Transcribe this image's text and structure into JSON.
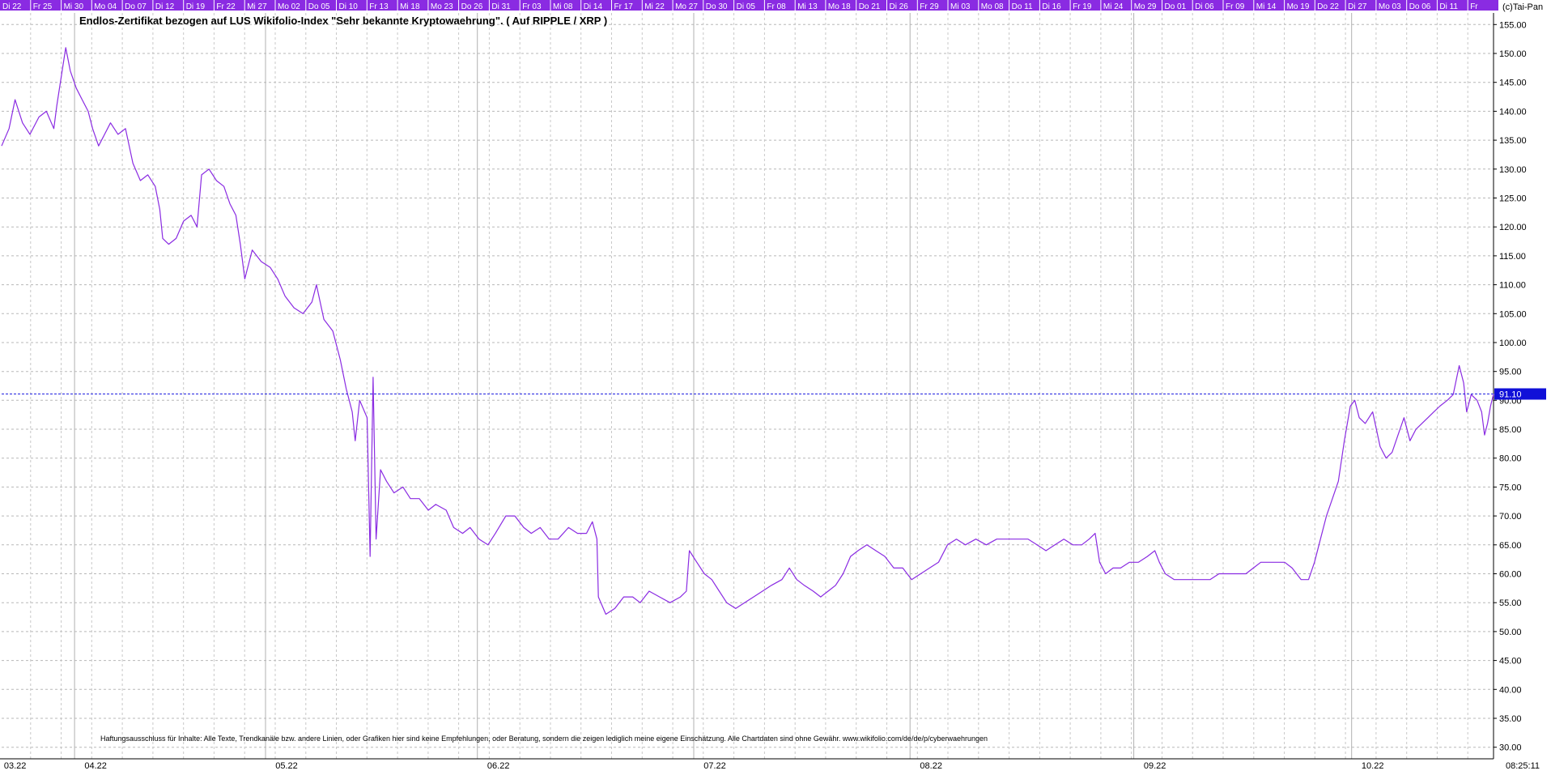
{
  "chart_data": {
    "type": "line",
    "title": "Endlos-Zertifikat bezogen auf LUS Wikifolio-Index \"Sehr bekannte Kryptowaehrung\". ( Auf RIPPLE / XRP )",
    "copyright": "(c)Tai-Pan",
    "disclaimer": "Haftungsausschluss für Inhalte: Alle Texte, Trendkanäle bzw. andere Linien, oder Grafiken hier sind keine Empfehlungen, oder Beratung, sondern die zeigen lediglich meine eigene Einschätzung. Alle Chartdaten sind ohne Gewähr.  www.wikifolio.com/de/de/p/cyberwaehrungen",
    "time_label": "08:25:11",
    "last_value_label": "91.10",
    "last_value": 91.1,
    "ylim": [
      28,
      157
    ],
    "y_ticks": [
      "30.00",
      "35.00",
      "40.00",
      "45.00",
      "50.00",
      "55.00",
      "60.00",
      "65.00",
      "70.00",
      "75.00",
      "80.00",
      "85.00",
      "90.00",
      "95.00",
      "100.00",
      "105.00",
      "110.00",
      "115.00",
      "120.00",
      "125.00",
      "130.00",
      "135.00",
      "140.00",
      "145.00",
      "150.00",
      "155.00"
    ],
    "x_range": [
      0,
      100
    ],
    "top_date_labels": [
      "Di 22",
      "Fr 25",
      "Mi 30",
      "Mo 04",
      "Do 07",
      "Di 12",
      "Di 19",
      "Fr 22",
      "Mi 27",
      "Mo 02",
      "Do 05",
      "Di 10",
      "Fr 13",
      "Mi 18",
      "Mo 23",
      "Do 26",
      "Di 31",
      "Fr 03",
      "Mi 08",
      "Di 14",
      "Fr 17",
      "Mi 22",
      "Mo 27",
      "Do 30",
      "Di 05",
      "Fr 08",
      "Mi 13",
      "Mo 18",
      "Do 21",
      "Di 26",
      "Fr 29",
      "Mi 03",
      "Mo 08",
      "Do 11",
      "Di 16",
      "Fr 19",
      "Mi 24",
      "Mo 29",
      "Do 01",
      "Di 06",
      "Fr 09",
      "Mi 14",
      "Mo 19",
      "Do 22",
      "Di 27",
      "Mo 03",
      "Do 06",
      "Di 11",
      "Fr"
    ],
    "bottom_month_labels": [
      "03.22",
      "04.22",
      "05.22",
      "06.22",
      "07.22",
      "08.22",
      "09.22",
      "10.22"
    ],
    "bottom_month_positions": [
      0.9,
      6.3,
      19.1,
      33.3,
      47.8,
      62.3,
      77.3,
      91.9
    ],
    "colors": {
      "line": "#8a2be2",
      "top_bar": "#8a2be2",
      "top_bar_text": "#ffffff",
      "grid": "#b8b8b8",
      "last_value_line": "#2020e0",
      "last_value_box": "#1010d8"
    },
    "series": [
      {
        "points": [
          [
            0.0,
            134
          ],
          [
            0.5,
            137
          ],
          [
            0.9,
            142
          ],
          [
            1.4,
            138
          ],
          [
            1.9,
            136
          ],
          [
            2.5,
            139
          ],
          [
            3.0,
            140
          ],
          [
            3.5,
            137
          ],
          [
            3.7,
            141
          ],
          [
            4.0,
            146
          ],
          [
            4.3,
            151
          ],
          [
            4.6,
            147
          ],
          [
            5.0,
            144
          ],
          [
            5.4,
            142
          ],
          [
            5.8,
            140
          ],
          [
            6.1,
            137
          ],
          [
            6.5,
            134
          ],
          [
            6.9,
            136
          ],
          [
            7.3,
            138
          ],
          [
            7.8,
            136
          ],
          [
            8.3,
            137
          ],
          [
            8.8,
            131
          ],
          [
            9.3,
            128
          ],
          [
            9.8,
            129
          ],
          [
            10.3,
            127
          ],
          [
            10.6,
            123
          ],
          [
            10.8,
            118
          ],
          [
            11.2,
            117
          ],
          [
            11.7,
            118
          ],
          [
            12.2,
            121
          ],
          [
            12.7,
            122
          ],
          [
            13.1,
            120
          ],
          [
            13.4,
            129
          ],
          [
            13.9,
            130
          ],
          [
            14.4,
            128
          ],
          [
            14.9,
            127
          ],
          [
            15.3,
            124
          ],
          [
            15.7,
            122
          ],
          [
            16.0,
            117
          ],
          [
            16.3,
            111
          ],
          [
            16.6,
            114
          ],
          [
            16.8,
            116
          ],
          [
            17.4,
            114
          ],
          [
            18.0,
            113
          ],
          [
            18.5,
            111
          ],
          [
            19.0,
            108
          ],
          [
            19.6,
            106
          ],
          [
            20.2,
            105
          ],
          [
            20.8,
            107
          ],
          [
            21.1,
            110
          ],
          [
            21.6,
            104
          ],
          [
            22.2,
            102
          ],
          [
            22.7,
            97
          ],
          [
            23.1,
            92
          ],
          [
            23.5,
            88
          ],
          [
            23.7,
            83
          ],
          [
            24.0,
            90
          ],
          [
            24.5,
            87
          ],
          [
            24.7,
            63
          ],
          [
            24.9,
            94
          ],
          [
            25.1,
            66
          ],
          [
            25.4,
            78
          ],
          [
            25.8,
            76
          ],
          [
            26.3,
            74
          ],
          [
            26.9,
            75
          ],
          [
            27.4,
            73
          ],
          [
            28.0,
            73
          ],
          [
            28.6,
            71
          ],
          [
            29.1,
            72
          ],
          [
            29.8,
            71
          ],
          [
            30.3,
            68
          ],
          [
            30.9,
            67
          ],
          [
            31.4,
            68
          ],
          [
            32.0,
            66
          ],
          [
            32.6,
            65
          ],
          [
            33.1,
            67
          ],
          [
            33.8,
            70
          ],
          [
            34.4,
            70
          ],
          [
            35.0,
            68
          ],
          [
            35.5,
            67
          ],
          [
            36.1,
            68
          ],
          [
            36.7,
            66
          ],
          [
            37.3,
            66
          ],
          [
            38.0,
            68
          ],
          [
            38.6,
            67
          ],
          [
            39.2,
            67
          ],
          [
            39.6,
            69
          ],
          [
            39.9,
            66
          ],
          [
            40.0,
            56
          ],
          [
            40.5,
            53
          ],
          [
            41.1,
            54
          ],
          [
            41.7,
            56
          ],
          [
            42.3,
            56
          ],
          [
            42.8,
            55
          ],
          [
            43.4,
            57
          ],
          [
            44.1,
            56
          ],
          [
            44.8,
            55
          ],
          [
            45.5,
            56
          ],
          [
            45.9,
            57
          ],
          [
            46.1,
            64
          ],
          [
            46.6,
            62
          ],
          [
            47.1,
            60
          ],
          [
            47.6,
            59
          ],
          [
            48.1,
            57
          ],
          [
            48.6,
            55
          ],
          [
            49.2,
            54
          ],
          [
            49.8,
            55
          ],
          [
            50.4,
            56
          ],
          [
            51.0,
            57
          ],
          [
            51.6,
            58
          ],
          [
            52.3,
            59
          ],
          [
            52.8,
            61
          ],
          [
            53.3,
            59
          ],
          [
            53.8,
            58
          ],
          [
            54.4,
            57
          ],
          [
            54.9,
            56
          ],
          [
            55.4,
            57
          ],
          [
            55.9,
            58
          ],
          [
            56.4,
            60
          ],
          [
            56.9,
            63
          ],
          [
            57.4,
            64
          ],
          [
            58.0,
            65
          ],
          [
            58.6,
            64
          ],
          [
            59.2,
            63
          ],
          [
            59.8,
            61
          ],
          [
            60.4,
            61
          ],
          [
            61.0,
            59
          ],
          [
            61.6,
            60
          ],
          [
            62.2,
            61
          ],
          [
            62.8,
            62
          ],
          [
            63.4,
            65
          ],
          [
            64.0,
            66
          ],
          [
            64.6,
            65
          ],
          [
            65.3,
            66
          ],
          [
            66.0,
            65
          ],
          [
            66.7,
            66
          ],
          [
            67.4,
            66
          ],
          [
            68.1,
            66
          ],
          [
            68.8,
            66
          ],
          [
            69.4,
            65
          ],
          [
            70.0,
            64
          ],
          [
            70.6,
            65
          ],
          [
            71.2,
            66
          ],
          [
            71.8,
            65
          ],
          [
            72.4,
            65
          ],
          [
            72.9,
            66
          ],
          [
            73.3,
            67
          ],
          [
            73.6,
            62
          ],
          [
            74.0,
            60
          ],
          [
            74.5,
            61
          ],
          [
            75.0,
            61
          ],
          [
            75.6,
            62
          ],
          [
            76.2,
            62
          ],
          [
            76.8,
            63
          ],
          [
            77.3,
            64
          ],
          [
            77.6,
            62
          ],
          [
            78.0,
            60
          ],
          [
            78.6,
            59
          ],
          [
            79.2,
            59
          ],
          [
            79.8,
            59
          ],
          [
            80.4,
            59
          ],
          [
            81.0,
            59
          ],
          [
            81.6,
            60
          ],
          [
            82.2,
            60
          ],
          [
            82.8,
            60
          ],
          [
            83.4,
            60
          ],
          [
            83.9,
            61
          ],
          [
            84.4,
            62
          ],
          [
            84.9,
            62
          ],
          [
            85.4,
            62
          ],
          [
            86.0,
            62
          ],
          [
            86.5,
            61
          ],
          [
            87.1,
            59
          ],
          [
            87.6,
            59
          ],
          [
            88.0,
            62
          ],
          [
            88.4,
            66
          ],
          [
            88.8,
            70
          ],
          [
            89.2,
            73
          ],
          [
            89.6,
            76
          ],
          [
            90.0,
            83
          ],
          [
            90.4,
            89
          ],
          [
            90.7,
            90
          ],
          [
            91.0,
            87
          ],
          [
            91.4,
            86
          ],
          [
            91.9,
            88
          ],
          [
            92.4,
            82
          ],
          [
            92.8,
            80
          ],
          [
            93.2,
            81
          ],
          [
            93.6,
            84
          ],
          [
            94.0,
            87
          ],
          [
            94.4,
            83
          ],
          [
            94.8,
            85
          ],
          [
            95.2,
            86
          ],
          [
            95.6,
            87
          ],
          [
            96.0,
            88
          ],
          [
            96.4,
            89
          ],
          [
            96.9,
            90
          ],
          [
            97.3,
            91
          ],
          [
            97.7,
            96
          ],
          [
            98.0,
            93
          ],
          [
            98.2,
            88
          ],
          [
            98.5,
            91
          ],
          [
            98.9,
            90
          ],
          [
            99.2,
            88
          ],
          [
            99.4,
            84
          ],
          [
            99.6,
            86
          ],
          [
            99.8,
            89
          ],
          [
            100.0,
            91.1
          ]
        ]
      }
    ]
  }
}
